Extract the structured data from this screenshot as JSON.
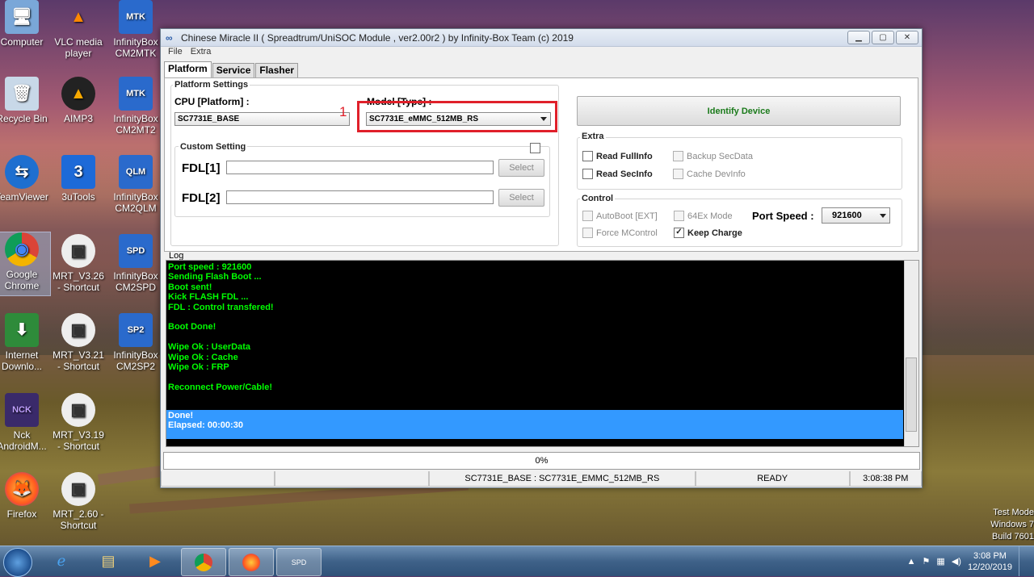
{
  "desktop": {
    "icons": [
      {
        "label": "Computer",
        "glyph": "🖥"
      },
      {
        "label": "VLC media player",
        "glyph": "▲"
      },
      {
        "label": "InfinityBox CM2MTK",
        "glyph": "MTK"
      },
      {
        "label": "Recycle Bin",
        "glyph": "🗑"
      },
      {
        "label": "AIMP3",
        "glyph": "▲"
      },
      {
        "label": "InfinityBox CM2MT2",
        "glyph": "MTK"
      },
      {
        "label": "TeamViewer",
        "glyph": "⇆"
      },
      {
        "label": "3uTools",
        "glyph": "3"
      },
      {
        "label": "InfinityBox CM2QLM",
        "glyph": "QLM"
      },
      {
        "label": "Google Chrome",
        "glyph": "◉"
      },
      {
        "label": "MRT_V3.26 - Shortcut",
        "glyph": "▣"
      },
      {
        "label": "InfinityBox CM2SPD",
        "glyph": "SPD"
      },
      {
        "label": "Internet Downlo...",
        "glyph": "⬇"
      },
      {
        "label": "MRT_V3.21 - Shortcut",
        "glyph": "▣"
      },
      {
        "label": "InfinityBox CM2SP2",
        "glyph": "SP2"
      },
      {
        "label": "Nck AndroidM...",
        "glyph": "NCK"
      },
      {
        "label": "MRT_V3.19 - Shortcut",
        "glyph": "▣"
      },
      {
        "label": "Firefox",
        "glyph": "🦊"
      },
      {
        "label": "MRT_2.60 - Shortcut",
        "glyph": "▣"
      }
    ],
    "watermark": [
      "Test Mode",
      "Windows 7",
      "Build 7601"
    ]
  },
  "window": {
    "title": "Chinese Miracle II ( Spreadtrum/UniSOC Module , ver2.00r2  ) by Infinity-Box Team (c) 2019",
    "menu": [
      "File",
      "Extra"
    ],
    "tabs": [
      "Platform",
      "Service",
      "Flasher"
    ],
    "platform_settings": {
      "group_label": "Platform Settings",
      "cpu_label": "CPU [Platform] :",
      "cpu_value": "SC7731E_BASE",
      "model_label": "Model [Type] :",
      "model_value": "SC7731E_eMMC_512MB_RS",
      "annotation_number": "1"
    },
    "custom_setting": {
      "label": "Custom Setting",
      "fdl1_label": "FDL[1]",
      "fdl2_label": "FDL[2]",
      "select_label": "Select"
    },
    "identify_button": "Identify Device",
    "extra": {
      "label": "Extra",
      "read_fullinfo": "Read FullInfo",
      "read_secinfo": "Read SecInfo",
      "backup_secdata": "Backup SecData",
      "cache_devinfo": "Cache DevInfo"
    },
    "control": {
      "label": "Control",
      "autoboot": "AutoBoot [EXT]",
      "force_mcontrol": "Force MControl",
      "ex64_mode": "64Ex Mode",
      "keep_charge": "Keep Charge",
      "port_speed_label": "Port Speed :",
      "port_speed_value": "921600"
    },
    "log": {
      "label": "Log",
      "lines": [
        "Port speed : 921600",
        "Sending Flash Boot ...",
        "Boot sent!",
        "Kick FLASH FDL ...",
        "FDL : Control transfered!",
        "",
        "Boot Done!",
        "",
        "Wipe Ok : UserData",
        "Wipe Ok : Cache",
        "Wipe Ok : FRP",
        "",
        "Reconnect Power/Cable!"
      ],
      "selected_lines": [
        "Done!",
        "Elapsed: 00:00:30"
      ]
    },
    "progress_text": "0%",
    "progress_value": 0,
    "status": {
      "platform": "SC7731E_BASE : SC7731E_EMMC_512MB_RS",
      "state": "READY",
      "time": "3:08:38 PM"
    }
  },
  "taskbar": {
    "clock_time": "3:08 PM",
    "clock_date": "12/20/2019",
    "items": [
      "Internet Explorer",
      "File Explorer",
      "Media Player",
      "Google Chrome",
      "Firefox",
      "InfinityBox CM2SPD"
    ]
  }
}
